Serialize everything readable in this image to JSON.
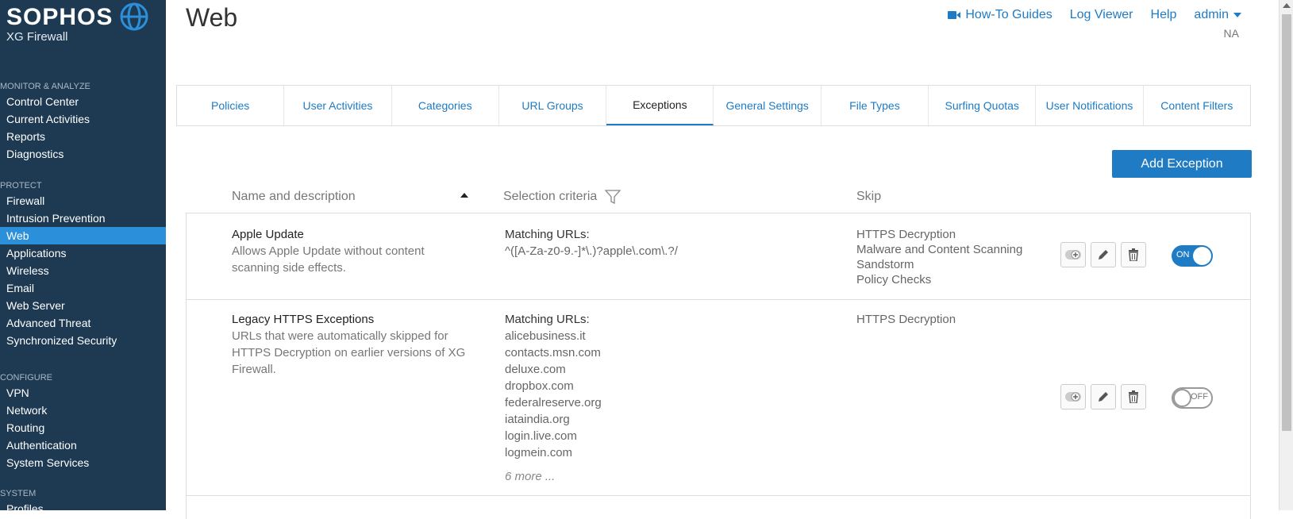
{
  "brand": {
    "name": "SOPHOS",
    "product": "XG Firewall"
  },
  "sidebar": {
    "sections": [
      {
        "heading": "MONITOR & ANALYZE",
        "items": [
          "Control Center",
          "Current Activities",
          "Reports",
          "Diagnostics"
        ]
      },
      {
        "heading": "PROTECT",
        "items": [
          "Firewall",
          "Intrusion Prevention",
          "Web",
          "Applications",
          "Wireless",
          "Email",
          "Web Server",
          "Advanced Threat",
          "Synchronized Security"
        ]
      },
      {
        "heading": "CONFIGURE",
        "items": [
          "VPN",
          "Network",
          "Routing",
          "Authentication",
          "System Services"
        ]
      },
      {
        "heading": "SYSTEM",
        "items": [
          "Profiles"
        ]
      }
    ],
    "active_item": "Web"
  },
  "header": {
    "title": "Web",
    "links": {
      "guides": "How-To Guides",
      "log_viewer": "Log Viewer",
      "help": "Help",
      "user": "admin"
    },
    "user_sub": "NA"
  },
  "tabs": [
    "Policies",
    "User Activities",
    "Categories",
    "URL Groups",
    "Exceptions",
    "General Settings",
    "File Types",
    "Surfing Quotas",
    "User Notifications",
    "Content Filters"
  ],
  "active_tab": "Exceptions",
  "add_button": "Add Exception",
  "columns": {
    "name": "Name and description",
    "criteria": "Selection criteria",
    "skip": "Skip"
  },
  "rows": [
    {
      "name": "Apple Update",
      "description": "Allows Apple Update without content scanning side effects.",
      "criteria_label": "Matching URLs:",
      "urls": [
        "^([A-Za-z0-9.-]*\\.)?apple\\.com\\.?/"
      ],
      "more": "",
      "skip": [
        "HTTPS Decryption",
        "Malware and Content Scanning",
        "Sandstorm",
        "Policy Checks"
      ],
      "toggle": "ON"
    },
    {
      "name": "Legacy HTTPS Exceptions",
      "description": "URLs that were automatically skipped for HTTPS Decryption on earlier versions of XG Firewall.",
      "criteria_label": "Matching URLs:",
      "urls": [
        "alicebusiness.it",
        "contacts.msn.com",
        "deluxe.com",
        "dropbox.com",
        "federalreserve.org",
        "iataindia.org",
        "login.live.com",
        "logmein.com"
      ],
      "more": "6 more ...",
      "skip": [
        "HTTPS Decryption"
      ],
      "toggle": "OFF"
    }
  ],
  "colors": {
    "sidebar_bg": "#1d3a52",
    "accent": "#1e7bc4",
    "active_nav": "#2b8fd9"
  }
}
